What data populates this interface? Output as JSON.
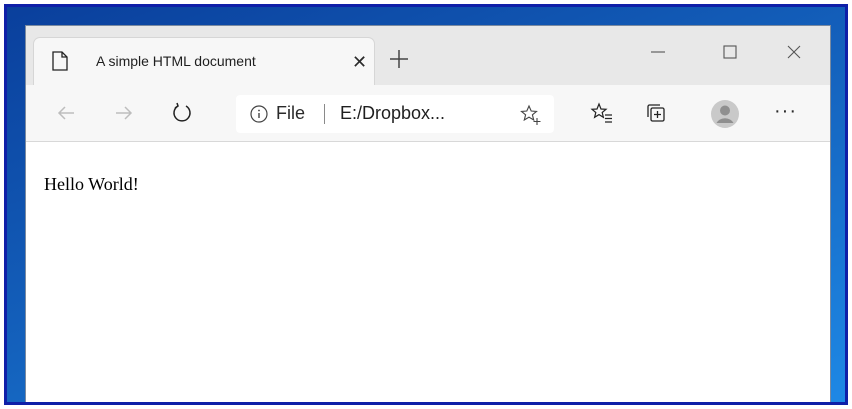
{
  "tab": {
    "title": "A simple HTML document",
    "close_icon": "close-icon",
    "page_icon": "page-icon"
  },
  "window_controls": [
    "minimize-icon",
    "maximize-icon",
    "close-icon"
  ],
  "toolbar": {
    "back_icon": "arrow-left-icon",
    "forward_icon": "arrow-right-icon",
    "refresh_icon": "refresh-icon",
    "address": {
      "info_icon": "info-icon",
      "scheme_label": "File",
      "url": "E:/Dropbox...",
      "favorite_icon": "star-plus-icon"
    },
    "favorites_icon": "favorites-list-icon",
    "collections_icon": "collections-icon",
    "profile_icon": "avatar",
    "more_label": "···"
  },
  "page": {
    "body_text": "Hello World!"
  },
  "colors": {
    "desktop": "#1565c0",
    "frame": "#0f1fa8",
    "tabstrip": "#e8e8e8",
    "toolbar": "#f7f7f7"
  }
}
